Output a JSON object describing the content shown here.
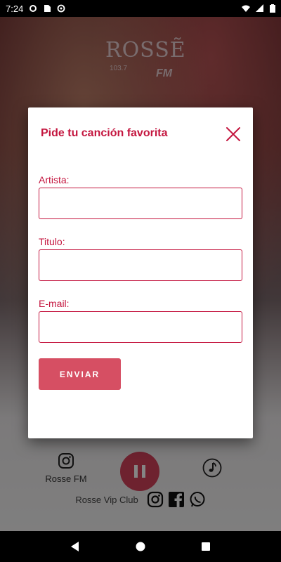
{
  "status_bar": {
    "time": "7:24",
    "icons": [
      "gear-icon",
      "sim-card-icon",
      "sync-icon",
      "wifi-icon",
      "signal-icon",
      "battery-icon"
    ]
  },
  "app": {
    "logo": {
      "brand": "ROSSẼ",
      "frequency": "103.7",
      "band": "FM"
    },
    "station_label": "Rosse FM",
    "club_label": "Rosse Vip Club",
    "player_state": "playing"
  },
  "dialog": {
    "title": "Pide tu canción favorita",
    "fields": [
      {
        "label": "Artista:",
        "value": ""
      },
      {
        "label": "Titulo:",
        "value": ""
      },
      {
        "label": "E-mail:",
        "value": ""
      }
    ],
    "submit_label": "ENVIAR"
  },
  "colors": {
    "accent": "#c4163f",
    "button": "#d64f63",
    "play_button": "#d4415a"
  }
}
